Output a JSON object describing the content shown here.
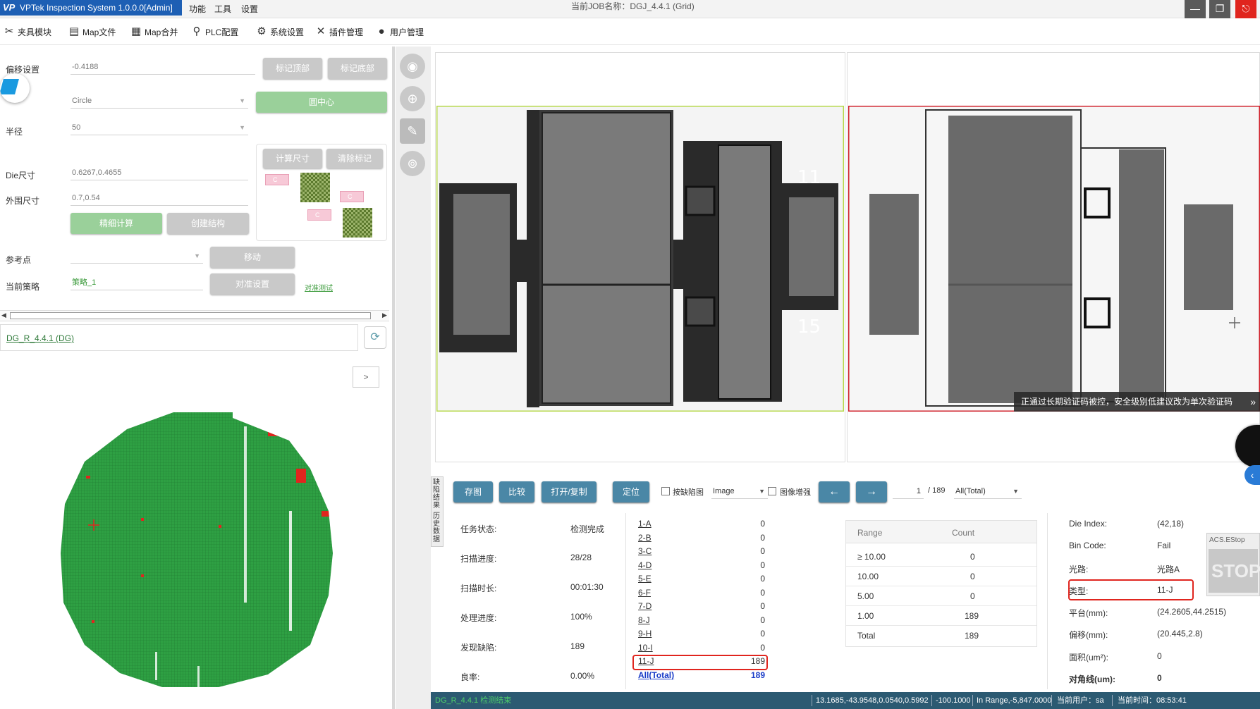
{
  "titlebar": {
    "app_title": "VPTek Inspection System 1.0.0.0[Admin]",
    "logo": "VP",
    "menus": [
      "功能",
      "工具",
      "设置"
    ],
    "job_title": "当前JOB名称：DGJ_4.4.1 (Grid)",
    "window_buttons": [
      "minimize-icon",
      "restore-icon",
      "exit-icon"
    ]
  },
  "toolbar": {
    "items": [
      {
        "label": "夹具模块",
        "icon": "fixture-icon"
      },
      {
        "label": "Map文件",
        "icon": "file-icon"
      },
      {
        "label": "Map合并",
        "icon": "merge-icon"
      },
      {
        "label": "PLC配置",
        "icon": "plc-icon"
      },
      {
        "label": "系统设置",
        "icon": "gear-icon"
      },
      {
        "label": "插件管理",
        "icon": "plugin-icon"
      },
      {
        "label": "用户管理",
        "icon": "user-icon"
      }
    ]
  },
  "left_panel": {
    "offset_label": "偏移设置",
    "offset_value": "-0.4188",
    "mark_top_button": "标记顶部",
    "mark_bottom_button": "标记底部",
    "shape_value": "Circle",
    "center_button": "圆中心",
    "radius_label": "半径",
    "radius_value": "50",
    "calc_size_button": "计算尺寸",
    "clear_mark_button": "清除标记",
    "die_size_label": "Die尺寸",
    "die_size_value": "0.6267,0.4655",
    "outer_size_label": "外围尺寸",
    "outer_size_value": "0.7,0.54",
    "fine_calc_button": "精细计算",
    "create_struct_button": "创建结构",
    "ref_point_label": "参考点",
    "ref_point_value": "",
    "move_button": "移动",
    "strategy_label": "当前策略",
    "strategy_value": "策略_1",
    "align_button": "对准设置",
    "align_test_link": "对准测试",
    "struct_marks": [
      "C",
      "C",
      "C"
    ],
    "recipe_link": "DG_R_4.4.1 (DG)",
    "expand_button": ">"
  },
  "wafer_map": {
    "fill_color": "#2ea043",
    "defect_color": "#e0251e",
    "total_dies": 189
  },
  "bottom": {
    "side_tabs": [
      "缺陷结果",
      "历史数据"
    ],
    "buttons": [
      "存图",
      "比较",
      "打开/复制",
      "定位"
    ],
    "defect_img_check": "按缺陷图",
    "image_select": "Image",
    "enhance_check": "图像增强",
    "prev_icon": "arrow-left-icon",
    "next_icon": "arrow-right-icon",
    "page_current": "1",
    "page_total": "/ 189",
    "filter_select": "All(Total)",
    "stats": [
      {
        "label": "任务状态:",
        "value": "检测完成"
      },
      {
        "label": "扫描进度:",
        "value": "28/28"
      },
      {
        "label": "扫描时长:",
        "value": "00:01:30"
      },
      {
        "label": "处理进度:",
        "value": "100%"
      },
      {
        "label": "发现缺陷:",
        "value": "189"
      },
      {
        "label": "良率:",
        "value": "0.00%"
      }
    ],
    "bins": [
      {
        "label": "1-A",
        "count": "0"
      },
      {
        "label": "2-B",
        "count": "0"
      },
      {
        "label": "3-C",
        "count": "0"
      },
      {
        "label": "4-D",
        "count": "0"
      },
      {
        "label": "5-E",
        "count": "0"
      },
      {
        "label": "6-F",
        "count": "0"
      },
      {
        "label": "7-D",
        "count": "0"
      },
      {
        "label": "8-J",
        "count": "0"
      },
      {
        "label": "9-H",
        "count": "0"
      },
      {
        "label": "10-I",
        "count": "0"
      },
      {
        "label": "11-J",
        "count": "189"
      },
      {
        "label": "All(Total)",
        "count": "189"
      }
    ],
    "range_table": {
      "headers": [
        "Range",
        "Count"
      ],
      "rows": [
        {
          "range": "≥ 10.00",
          "count": "0"
        },
        {
          "range": "10.00",
          "count": "0"
        },
        {
          "range": "5.00",
          "count": "0"
        },
        {
          "range": "1.00",
          "count": "189"
        },
        {
          "range": "Total",
          "count": "189"
        }
      ]
    },
    "info": [
      {
        "label": "Die Index:",
        "value": "(42,18)"
      },
      {
        "label": "Bin Code:",
        "value": "Fail"
      },
      {
        "label": "光路:",
        "value": "光路A"
      },
      {
        "label": "类型:",
        "value": "11-J"
      },
      {
        "label": "平台(mm):",
        "value": "(24.2605,44.2515)"
      },
      {
        "label": "偏移(mm):",
        "value": "(20.445,2.8)"
      },
      {
        "label": "面积(um²):",
        "value": "0"
      },
      {
        "label": "对角线(um):",
        "value": "0"
      }
    ],
    "estop_label": "ACS.EStop",
    "estop_text": "STOP"
  },
  "notice": "正通过长期验证码被控，安全级别低建议改为单次验证码",
  "statusbar": {
    "left": "DG_R_4.4.1 检测结束",
    "coords": "13.1685,-43.9548,0.0540,0.5992",
    "z": "-100.1000",
    "range": "In Range,-5,847.0000",
    "user": "当前用户：sa",
    "time": "当前时间：08:53:41"
  }
}
